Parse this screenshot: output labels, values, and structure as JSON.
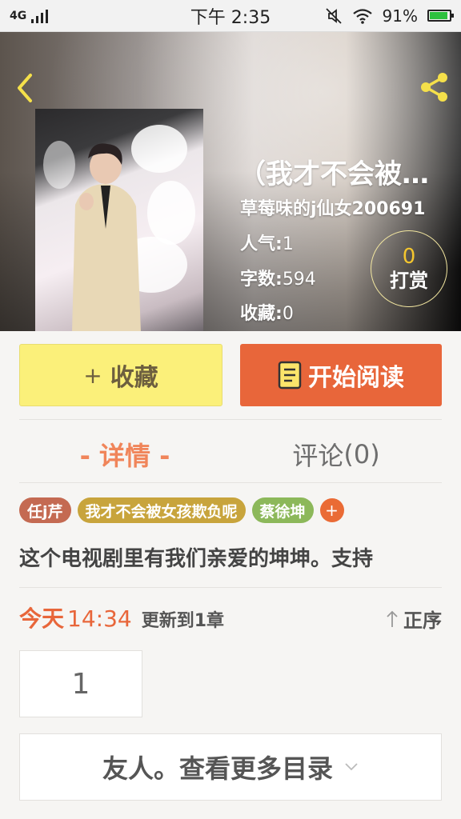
{
  "status_bar": {
    "network": "4G",
    "time": "下午 2:35",
    "battery_percent": "91%",
    "battery_level": 0.91
  },
  "book": {
    "title": "（我才不会被…",
    "author": "草莓味的j仙女200691",
    "popularity_label": "人气:",
    "popularity_value": "1",
    "word_count_label": "字数:",
    "word_count_value": "594",
    "favorites_label": "收藏:",
    "favorites_value": "0",
    "tip_count": "0",
    "tip_label": "打赏"
  },
  "actions": {
    "collect_plus": "+",
    "collect_label": "收藏",
    "read_label": "开始阅读"
  },
  "tabs": {
    "details": "- 详情 -",
    "comments": "评论",
    "comments_count": "(0)"
  },
  "tags": [
    {
      "label": "任j芹",
      "color": "#c46a52"
    },
    {
      "label": "我才不会被女孩欺负呢",
      "color": "#c8a43c"
    },
    {
      "label": "蔡徐坤",
      "color": "#8cb85a"
    }
  ],
  "tag_more": "+",
  "summary": "这个电视剧里有我们亲爱的坤坤。支持",
  "update": {
    "day": "今天",
    "time": "14:34",
    "text": "更新到1章"
  },
  "sort_label": "正序",
  "chapters": [
    "1"
  ],
  "more_button": "友人。查看更多目录",
  "colors": {
    "accent_orange": "#e8663a",
    "collect_yellow": "#fbf07a",
    "tab_active": "#f0855a",
    "tip_gold": "#f4c62e"
  },
  "icons": {
    "back": "chevron-left-icon",
    "share": "share-icon",
    "read": "book-icon",
    "sort": "arrow-up-icon",
    "expand": "chevron-down-icon"
  }
}
